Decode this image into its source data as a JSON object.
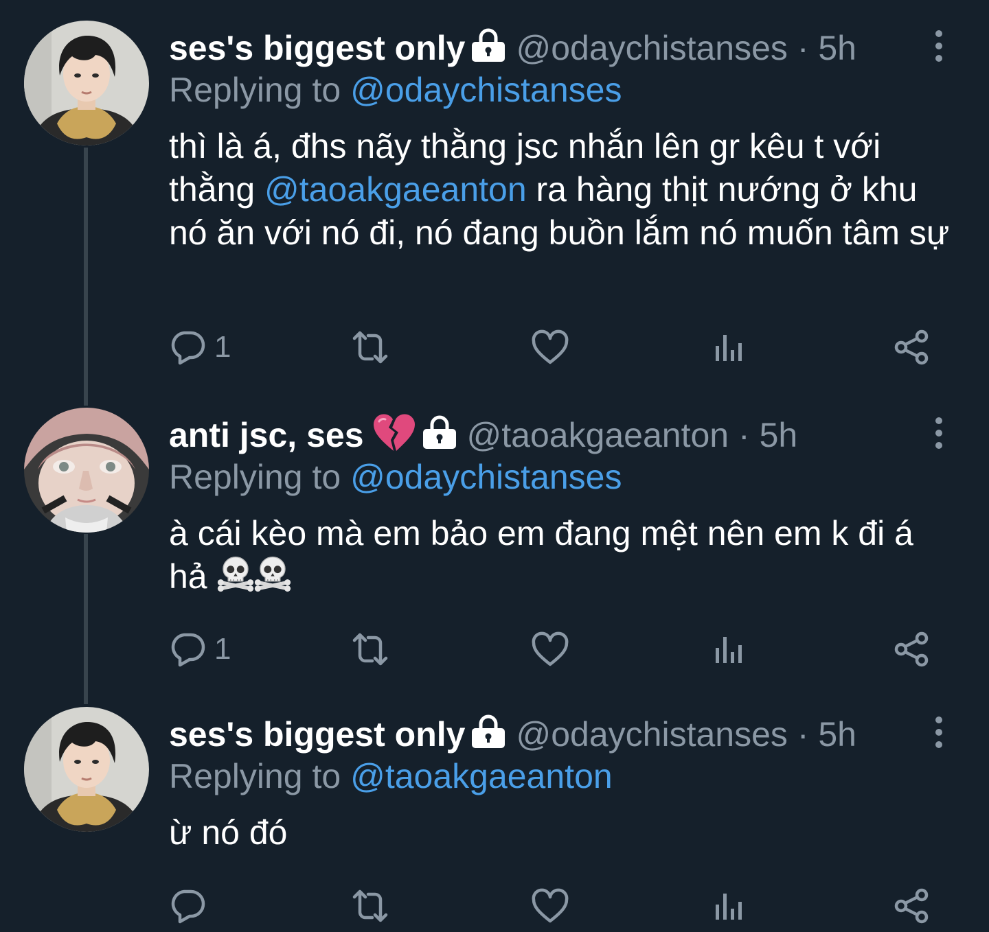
{
  "theme": {
    "background": "#15202b",
    "text_primary": "#ffffff",
    "text_secondary": "#8b98a5",
    "accent": "#4a9fe8",
    "connector": "#38444d"
  },
  "tweets": [
    {
      "display_name": "ses's biggest only",
      "badge_icon": "lock-icon",
      "handle": "@odaychistanses",
      "separator": "·",
      "time": "5h",
      "replying_prefix": "Replying to",
      "replying_to": "@odaychistanses",
      "body_parts": [
        "thì là á, đhs nãy thằng jsc nhắn lên gr kêu t với thằng ",
        "@taoakgaeanton",
        " ra hàng thịt nướng ở khu nó ăn với nó đi, nó đang buồn lắm nó muốn tâm sự"
      ],
      "reply_count": "1",
      "retweet_count": "",
      "like_count": ""
    },
    {
      "display_name": "anti jsc, ses",
      "emoji": "broken-heart-emoji",
      "badge_icon": "lock-icon",
      "handle": "@taoakgaeanton",
      "separator": "·",
      "time": "5h",
      "replying_prefix": "Replying to",
      "replying_to": "@odaychistanses",
      "body_text": "à cái kèo mà em bảo em đang mệt nên em k đi á hả",
      "body_emojis": [
        "skull-crossbones-emoji",
        "skull-crossbones-emoji"
      ],
      "reply_count": "1",
      "retweet_count": "",
      "like_count": ""
    },
    {
      "display_name": "ses's biggest only",
      "badge_icon": "lock-icon",
      "handle": "@odaychistanses",
      "separator": "·",
      "time": "5h",
      "replying_prefix": "Replying to",
      "replying_to": "@taoakgaeanton",
      "body_text": "ừ nó đó",
      "reply_count": "",
      "retweet_count": "",
      "like_count": ""
    }
  ],
  "action_icons": [
    "reply-icon",
    "retweet-icon",
    "like-icon",
    "analytics-icon",
    "share-icon"
  ]
}
